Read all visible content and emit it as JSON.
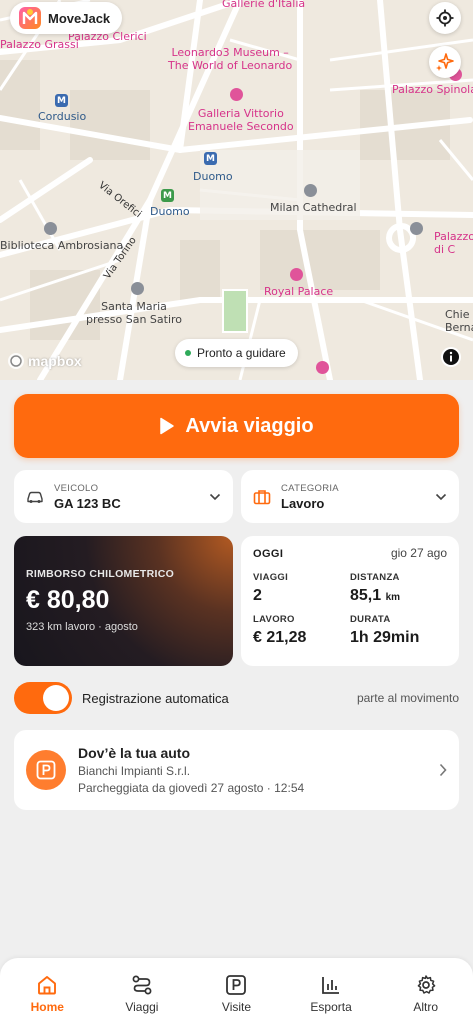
{
  "app": {
    "name": "MoveJack",
    "accent": "#ff6a0e"
  },
  "map": {
    "labels": {
      "galleria_italia": "Gallerie d'Italia",
      "palazzo_clerici": "Palazzo Clerici",
      "palazzo_grassi": "Palazzo Grassi",
      "leonardo3_1": "Leonardo3 Museum –",
      "leonardo3_2": "The World of Leonardo",
      "palazzo_spinola": "Palazzo Spinola",
      "cordusio": "Cordusio",
      "galleria_1": "Galleria Vittorio",
      "galleria_2": "Emanuele Secondo",
      "duomo_metro": "Duomo",
      "duomo_tram": "Duomo",
      "via_orefici": "Via Orefici",
      "milan_cathedral": "Milan Cathedral",
      "biblioteca": "Biblioteca Ambrosiana",
      "palazzo_edge": "Palazzo",
      "palazzo_edge_2": "di C",
      "via_torino": "Via Torino",
      "royal_palace": "Royal Palace",
      "santa_maria_1": "Santa Maria",
      "santa_maria_2": "presso San Satiro",
      "chie": "Chie",
      "berna": "Berna"
    },
    "status": "Pronto a guidare",
    "attribution": "mapbox"
  },
  "actions": {
    "start_trip": "Avvia viaggio"
  },
  "vehicle": {
    "caption": "VEICOLO",
    "value": "GA 123 BC"
  },
  "category": {
    "caption": "CATEGORIA",
    "value": "Lavoro"
  },
  "reimbursement": {
    "caption": "RIMBORSO CHILOMETRICO",
    "amount": "€ 80,80",
    "detail": "323 km lavoro · agosto"
  },
  "today": {
    "title": "OGGI",
    "date": "gio 27 ago",
    "trips_label": "VIAGGI",
    "trips_value": "2",
    "distance_label": "DISTANZA",
    "distance_value": "85,1",
    "distance_unit": "km",
    "work_label": "LAVORO",
    "work_value": "€ 21,28",
    "duration_label": "DURATA",
    "duration_value": "1h 29min"
  },
  "auto_record": {
    "label": "Registrazione automatica",
    "hint": "parte al movimento",
    "enabled": true
  },
  "car_location": {
    "title": "Dov’è la tua auto",
    "place": "Bianchi Impianti S.r.l.",
    "parked": "Parcheggiata da giovedì 27 agosto · 12:54"
  },
  "nav": {
    "home": "Home",
    "trips": "Viaggi",
    "visits": "Visite",
    "export": "Esporta",
    "more": "Altro"
  }
}
